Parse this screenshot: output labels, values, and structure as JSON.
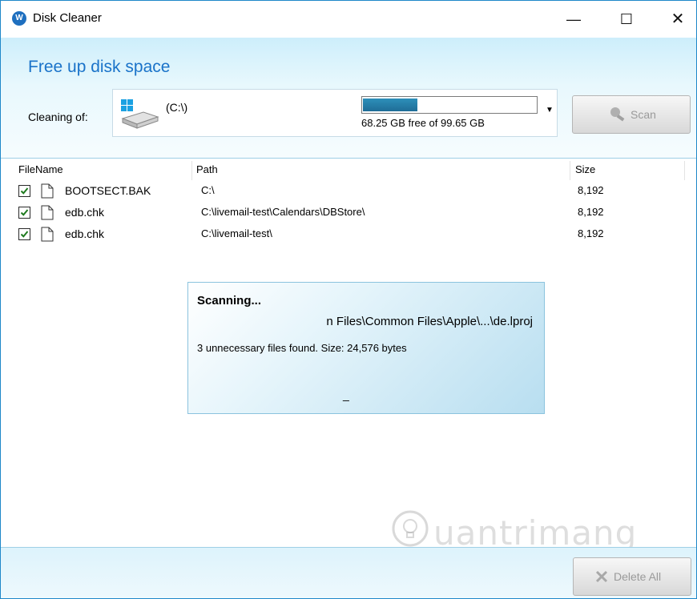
{
  "window": {
    "title": "Disk Cleaner",
    "app_icon_text": "W",
    "controls": {
      "minimize": "—",
      "maximize": "☐",
      "close": "✕"
    }
  },
  "header": {
    "subtitle": "Free up disk space",
    "cleaning_label": "Cleaning of:",
    "drive": {
      "name": "(C:\\)",
      "free_text": "68.25 GB free of 99.65 GB",
      "used_fraction": 0.315
    },
    "scan_button": {
      "label": "Scan"
    }
  },
  "table": {
    "columns": {
      "file": "FileName",
      "path": "Path",
      "size": "Size"
    },
    "rows": [
      {
        "checked": true,
        "name": "BOOTSECT.BAK",
        "path": "C:\\",
        "size": "8,192"
      },
      {
        "checked": true,
        "name": "edb.chk",
        "path": "C:\\livemail-test\\Calendars\\DBStore\\",
        "size": "8,192"
      },
      {
        "checked": true,
        "name": "edb.chk",
        "path": "C:\\livemail-test\\",
        "size": "8,192"
      }
    ]
  },
  "scan_dialog": {
    "title": "Scanning...",
    "current_path": "n Files\\Common Files\\Apple\\...\\de.lproj",
    "found_text": "3 unnecessary files found. Size: 24,576 bytes",
    "cursor": "_"
  },
  "footer": {
    "delete_button": {
      "label": "Delete All"
    }
  },
  "watermark": {
    "text": "uantrimang"
  },
  "colors": {
    "accent": "#1a73c9",
    "usage_fill": "#2184b0",
    "header_bg": "#e8f8fd"
  }
}
